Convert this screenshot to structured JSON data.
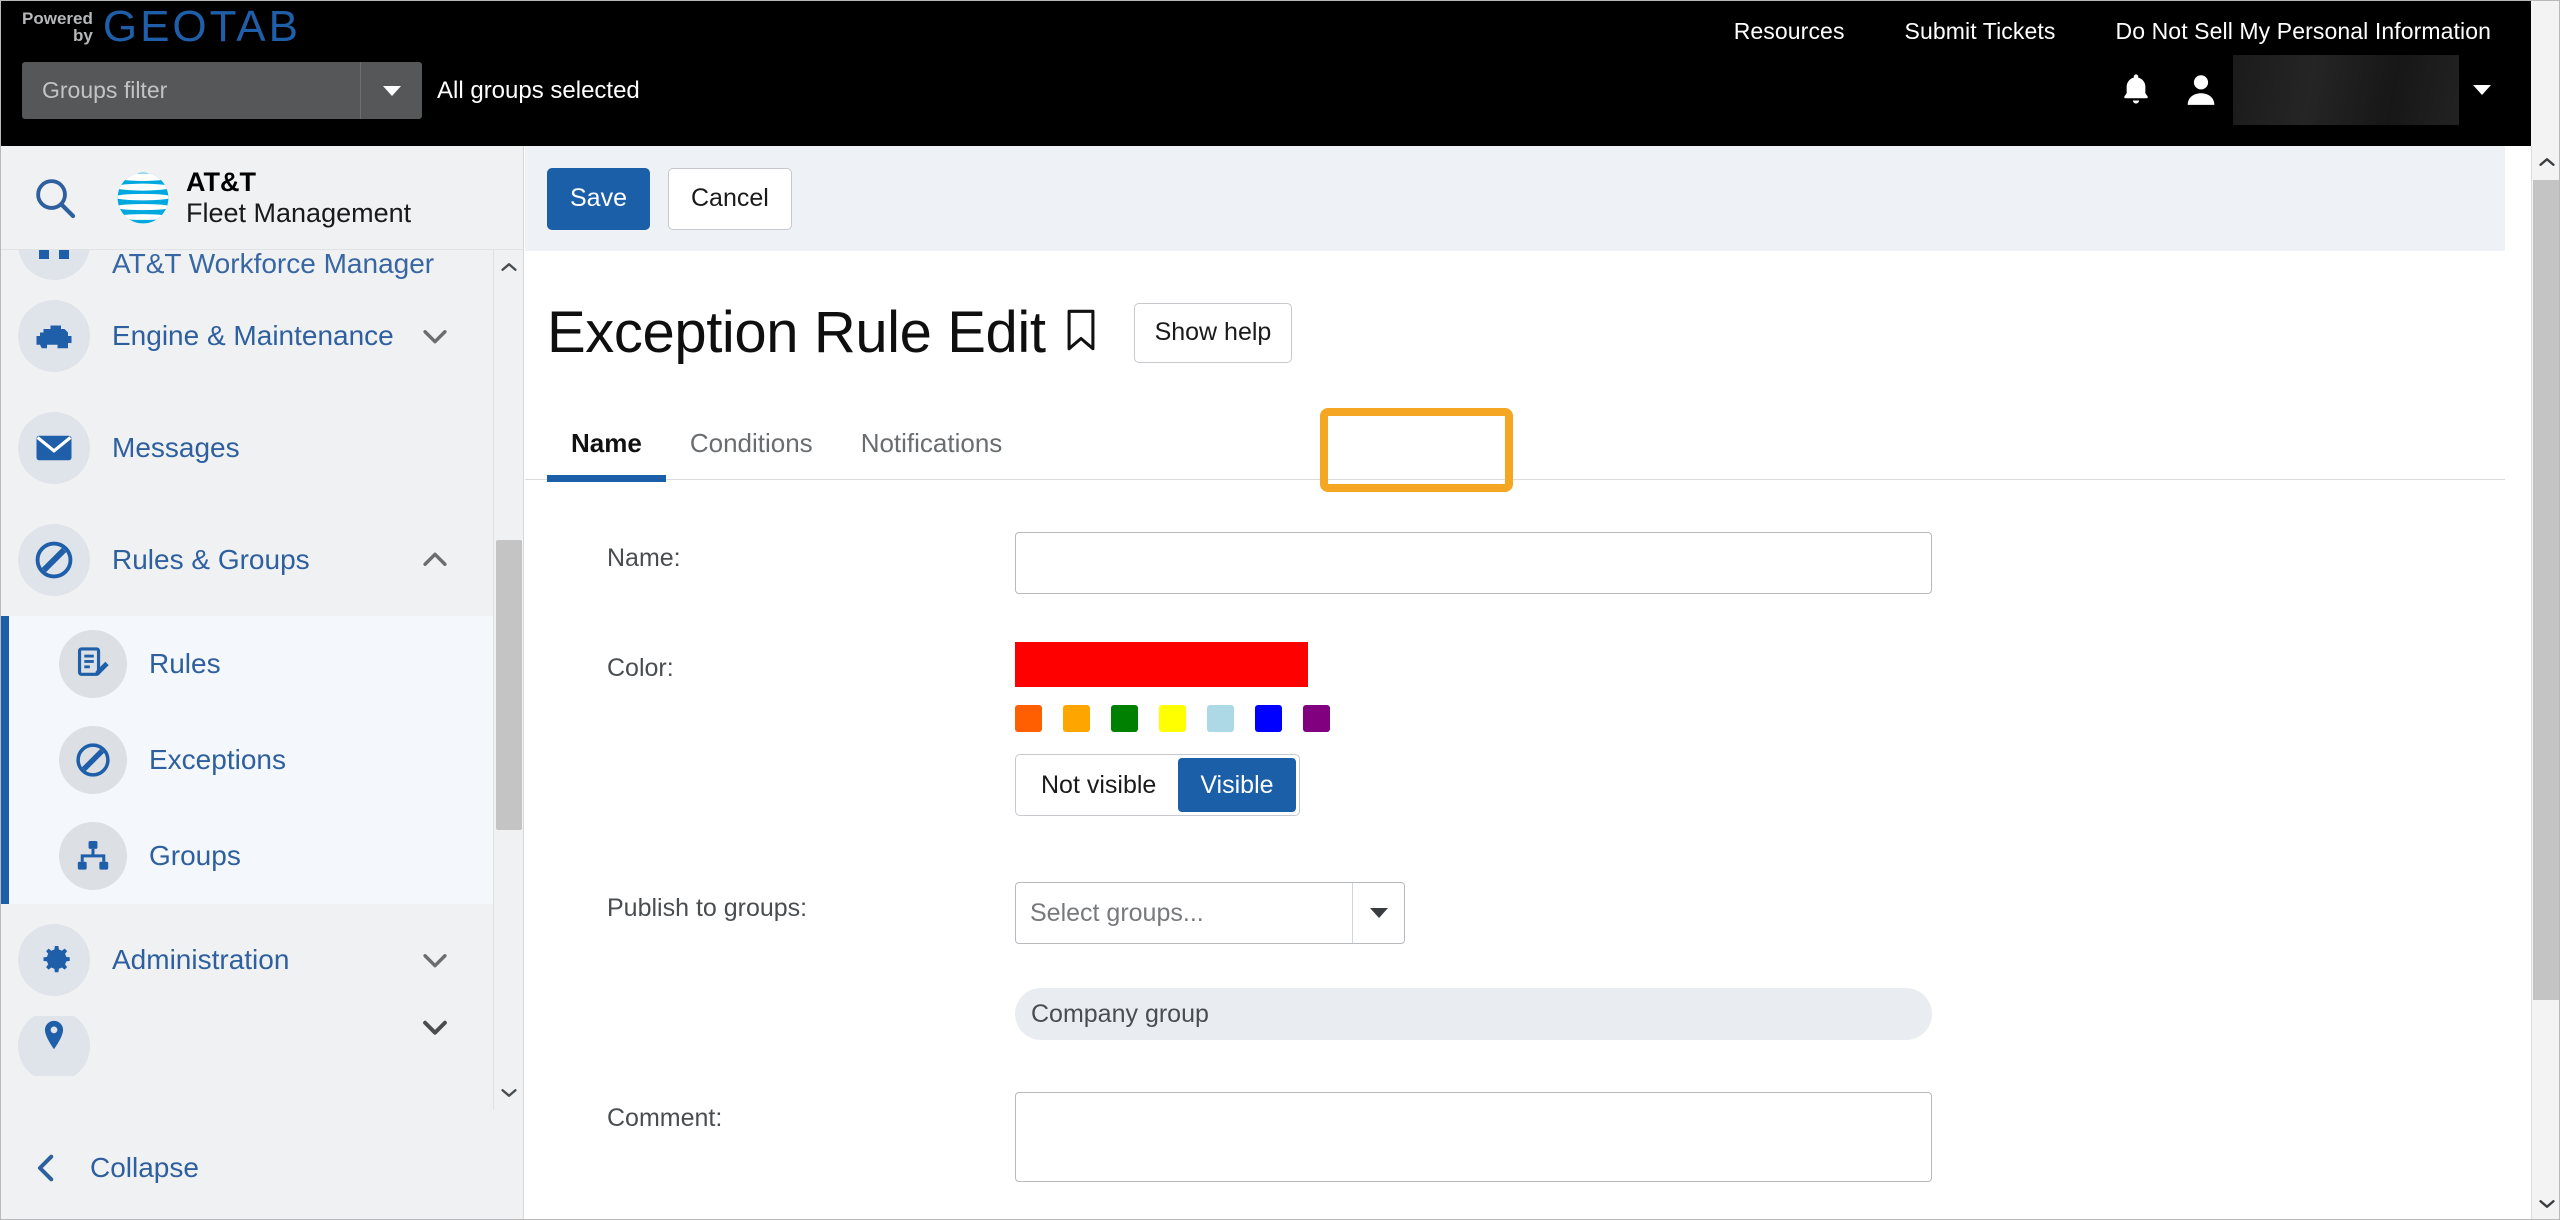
{
  "topbar": {
    "brand_powered": "Powered",
    "brand_by": "by",
    "brand_geotab": "GEOTAB",
    "links": [
      {
        "label": "Resources"
      },
      {
        "label": "Submit Tickets"
      },
      {
        "label": "Do Not Sell My Personal Information"
      }
    ],
    "groups_filter_placeholder": "Groups filter",
    "groups_filter_value": "",
    "all_groups_selected": "All groups selected",
    "bell_icon": "bell-icon",
    "avatar_icon": "user-avatar-icon",
    "user_name": "",
    "user_caret_icon": "chevron-down-icon"
  },
  "sidebar": {
    "search_icon": "search-icon",
    "brand_line1": "AT&T",
    "brand_line2": "Fleet Management",
    "top_partial_label": "AT&T Workforce Manager",
    "items": [
      {
        "label": "Engine & Maintenance",
        "icon": "engine-icon",
        "chevron": "chevron-down-icon"
      },
      {
        "label": "Messages",
        "icon": "envelope-icon",
        "chevron": ""
      },
      {
        "label": "Rules & Groups",
        "icon": "no-entry-icon",
        "chevron": "chevron-up-icon"
      }
    ],
    "sub_items": [
      {
        "label": "Rules",
        "icon": "rules-document-edit-icon"
      },
      {
        "label": "Exceptions",
        "icon": "no-entry-icon"
      },
      {
        "label": "Groups",
        "icon": "org-chart-icon"
      }
    ],
    "admin": {
      "label": "Administration",
      "icon": "gear-icon",
      "chevron": "chevron-down-icon"
    },
    "partial_item": {
      "label": "",
      "icon": "map-pin-icon",
      "chevron": "chevron-down-icon"
    },
    "collapse": {
      "label": "Collapse",
      "icon": "chevron-left-icon"
    },
    "scroll_up_icon": "chevron-up-icon",
    "scroll_down_icon": "chevron-down-icon"
  },
  "main": {
    "toolbar": {
      "save_label": "Save",
      "cancel_label": "Cancel"
    },
    "page_title": "Exception Rule Edit",
    "bookmark_icon": "bookmark-icon",
    "show_help_label": "Show help",
    "tabs": [
      {
        "label": "Name",
        "active": true
      },
      {
        "label": "Conditions",
        "active": false
      },
      {
        "label": "Notifications",
        "active": false,
        "highlighted": true
      }
    ],
    "form": {
      "name_label": "Name:",
      "name_value": "",
      "name_placeholder": "",
      "color_label": "Color:",
      "color_selected": "#FF0000",
      "swatches": [
        "#FF5F00",
        "#FFA500",
        "#008000",
        "#FFFF00",
        "#ADD8E6",
        "#0000FF",
        "#800080"
      ],
      "visibility": {
        "not_visible_label": "Not visible",
        "visible_label": "Visible",
        "selected": "Visible"
      },
      "publish_label": "Publish to groups:",
      "publish_placeholder": "Select groups...",
      "publish_value": "",
      "group_chip": "Company group",
      "comment_label": "Comment:",
      "comment_value": "",
      "comment_placeholder": ""
    }
  },
  "colors": {
    "accent_blue": "#1b5fa8",
    "highlight_orange": "#f5a623",
    "topbar_black": "#000000",
    "sidebar_bg": "#f0f1f2",
    "att_blue": "#00a8e0"
  },
  "scrollbar": {
    "up_icon": "chevron-up-icon",
    "down_icon": "chevron-down-icon"
  }
}
